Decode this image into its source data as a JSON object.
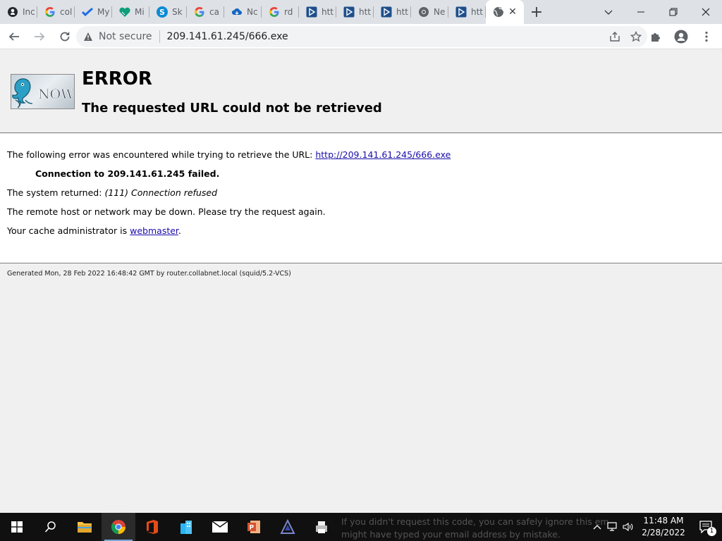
{
  "browser": {
    "tabs": [
      {
        "label": "Inc",
        "icon": "github-icon"
      },
      {
        "label": "col",
        "icon": "google-icon"
      },
      {
        "label": "My",
        "icon": "checkmark-icon"
      },
      {
        "label": "Mi",
        "icon": "heart-shield-icon"
      },
      {
        "label": "Sk",
        "icon": "skype-icon"
      },
      {
        "label": "ca",
        "icon": "google-icon"
      },
      {
        "label": "Nc",
        "icon": "cloud-icon"
      },
      {
        "label": "rd",
        "icon": "google-icon"
      },
      {
        "label": "htt",
        "icon": "play-icon"
      },
      {
        "label": "htt",
        "icon": "play-icon"
      },
      {
        "label": "htt",
        "icon": "play-icon"
      },
      {
        "label": "Ne",
        "icon": "chrome-icon"
      },
      {
        "label": "htt",
        "icon": "play-icon"
      }
    ],
    "active_tab_icon": "globe-icon",
    "new_tab_label": "+",
    "address": {
      "security": "Not secure",
      "url": "209.141.61.245/666.exe"
    }
  },
  "page": {
    "title": "ERROR",
    "subtitle": "The requested URL could not be retrieved",
    "intro": "The following error was encountered while trying to retrieve the URL:",
    "link_url": "http://209.141.61.245/666.exe",
    "connection_failed": "Connection to 209.141.61.245 failed.",
    "system_returned_label": "The system returned:",
    "system_returned_value": "(111) Connection refused",
    "remote_host": "The remote host or network may be down. Please try the request again.",
    "admin_text": "Your cache administrator is",
    "admin_link": "webmaster",
    "admin_period": ".",
    "footer": "Generated Mon, 28 Feb 2022 16:48:42 GMT by router.collabnet.local (squid/5.2-VCS)"
  },
  "taskbar": {
    "background_text_line1": "If you didn't request this code, you can safely ignore this email. Some",
    "background_text_line2": "might have typed your email address by mistake.",
    "time": "11:48 AM",
    "date": "2/28/2022",
    "notification_count": "1"
  },
  "colors": {
    "link": "#1a0dab",
    "chrome_tabstrip": "#dee1e6",
    "taskbar": "#101010"
  }
}
